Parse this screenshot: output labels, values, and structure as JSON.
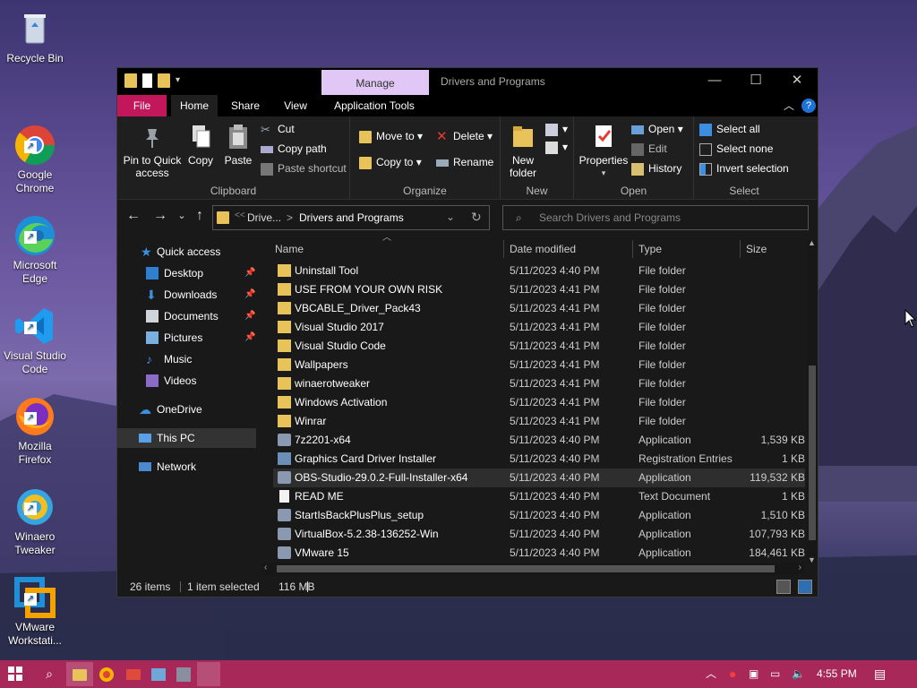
{
  "desktop": {
    "icons": [
      {
        "label": "Recycle Bin"
      },
      {
        "label": "Google\nChrome"
      },
      {
        "label": "Microsoft\nEdge"
      },
      {
        "label": "Visual Studio\nCode"
      },
      {
        "label": "Mozilla\nFirefox"
      },
      {
        "label": "Winaero\nTweaker"
      },
      {
        "label": "VMware\nWorkstati..."
      }
    ]
  },
  "window": {
    "title": "Drivers and Programs",
    "manage_tab": "Manage",
    "tabs": {
      "file": "File",
      "home": "Home",
      "share": "Share",
      "view": "View",
      "app_tools": "Application Tools"
    }
  },
  "ribbon": {
    "clipboard": {
      "pin": "Pin to Quick access",
      "copy": "Copy",
      "paste": "Paste",
      "cut": "Cut",
      "copy_path": "Copy path",
      "paste_shortcut": "Paste shortcut",
      "label": "Clipboard"
    },
    "organize": {
      "move_to": "Move to",
      "copy_to": "Copy to",
      "delete": "Delete",
      "rename": "Rename",
      "label": "Organize"
    },
    "new": {
      "new_folder": "New folder",
      "label": "New"
    },
    "open": {
      "properties": "Properties",
      "open": "Open",
      "edit": "Edit",
      "history": "History",
      "label": "Open"
    },
    "select": {
      "select_all": "Select all",
      "select_none": "Select none",
      "invert": "Invert selection",
      "label": "Select"
    }
  },
  "address": {
    "crumb_1": "Drive...",
    "crumb_2": "Drivers and Programs",
    "sep": ">",
    "prefix": "<<"
  },
  "search": {
    "placeholder": "Search Drivers and Programs"
  },
  "nav": {
    "quick_access": "Quick access",
    "desktop": "Desktop",
    "downloads": "Downloads",
    "documents": "Documents",
    "pictures": "Pictures",
    "music": "Music",
    "videos": "Videos",
    "onedrive": "OneDrive",
    "this_pc": "This PC",
    "network": "Network"
  },
  "columns": {
    "name": "Name",
    "date": "Date modified",
    "type": "Type",
    "size": "Size"
  },
  "files": [
    {
      "name": "Uninstall Tool",
      "date": "5/11/2023 4:40 PM",
      "type": "File folder",
      "size": ""
    },
    {
      "name": "USE FROM YOUR OWN RISK",
      "date": "5/11/2023 4:41 PM",
      "type": "File folder",
      "size": ""
    },
    {
      "name": "VBCABLE_Driver_Pack43",
      "date": "5/11/2023 4:41 PM",
      "type": "File folder",
      "size": ""
    },
    {
      "name": "Visual Studio 2017",
      "date": "5/11/2023 4:41 PM",
      "type": "File folder",
      "size": ""
    },
    {
      "name": "Visual Studio Code",
      "date": "5/11/2023 4:41 PM",
      "type": "File folder",
      "size": ""
    },
    {
      "name": "Wallpapers",
      "date": "5/11/2023 4:41 PM",
      "type": "File folder",
      "size": ""
    },
    {
      "name": "winaerotweaker",
      "date": "5/11/2023 4:41 PM",
      "type": "File folder",
      "size": ""
    },
    {
      "name": "Windows Activation",
      "date": "5/11/2023 4:41 PM",
      "type": "File folder",
      "size": ""
    },
    {
      "name": "Winrar",
      "date": "5/11/2023 4:41 PM",
      "type": "File folder",
      "size": ""
    },
    {
      "name": "7z2201-x64",
      "date": "5/11/2023 4:40 PM",
      "type": "Application",
      "size": "1,539 KB"
    },
    {
      "name": "Graphics Card Driver Installer",
      "date": "5/11/2023 4:40 PM",
      "type": "Registration Entries",
      "size": "1 KB"
    },
    {
      "name": "OBS-Studio-29.0.2-Full-Installer-x64",
      "date": "5/11/2023 4:40 PM",
      "type": "Application",
      "size": "119,532 KB"
    },
    {
      "name": "READ ME",
      "date": "5/11/2023 4:40 PM",
      "type": "Text Document",
      "size": "1 KB"
    },
    {
      "name": "StartIsBackPlusPlus_setup",
      "date": "5/11/2023 4:40 PM",
      "type": "Application",
      "size": "1,510 KB"
    },
    {
      "name": "VirtualBox-5.2.38-136252-Win",
      "date": "5/11/2023 4:40 PM",
      "type": "Application",
      "size": "107,793 KB"
    },
    {
      "name": "VMware 15",
      "date": "5/11/2023 4:40 PM",
      "type": "Application",
      "size": "184,461 KB"
    }
  ],
  "status": {
    "count": "26 items",
    "selected": "1 item selected",
    "size": "116 MB"
  },
  "taskbar": {
    "time": "4:55 PM"
  },
  "colors": {
    "accent": "#c2185b",
    "taskbar": "#a8285a",
    "manage": "#e1c7f5",
    "folder": "#e8c35a"
  }
}
